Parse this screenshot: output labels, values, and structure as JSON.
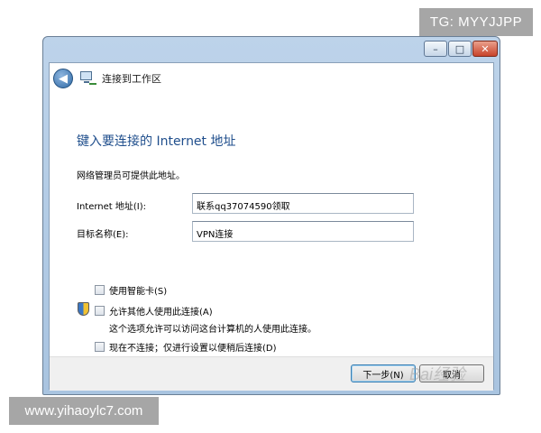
{
  "overlays": {
    "top_watermark": "TG: MYYJJPP",
    "bottom_watermark": "www.yihaoylc7.com",
    "faint_watermark": "Bai经验"
  },
  "window": {
    "nav_title": "连接到工作区",
    "heading": "键入要连接的 Internet 地址",
    "description": "网络管理员可提供此地址。",
    "fields": {
      "internet_address_label": "Internet 地址(I):",
      "internet_address_value": "联系qq37074590领取",
      "destination_name_label": "目标名称(E):",
      "destination_name_value": "VPN连接"
    },
    "options": {
      "smart_card_label": "使用智能卡(S)",
      "smart_card_checked": false,
      "allow_others_label": "允许其他人使用此连接(A)",
      "allow_others_checked": false,
      "allow_others_note": "这个选项允许可以访问这台计算机的人使用此连接。",
      "dont_connect_label": "现在不连接；仅进行设置以便稍后连接(D)",
      "dont_connect_checked": false
    },
    "buttons": {
      "next_label": "下一步(N)",
      "cancel_label": "取消"
    },
    "caption": {
      "minimize_glyph": "–",
      "maximize_glyph": "□",
      "close_glyph": "✕"
    },
    "back_glyph": "◀"
  }
}
